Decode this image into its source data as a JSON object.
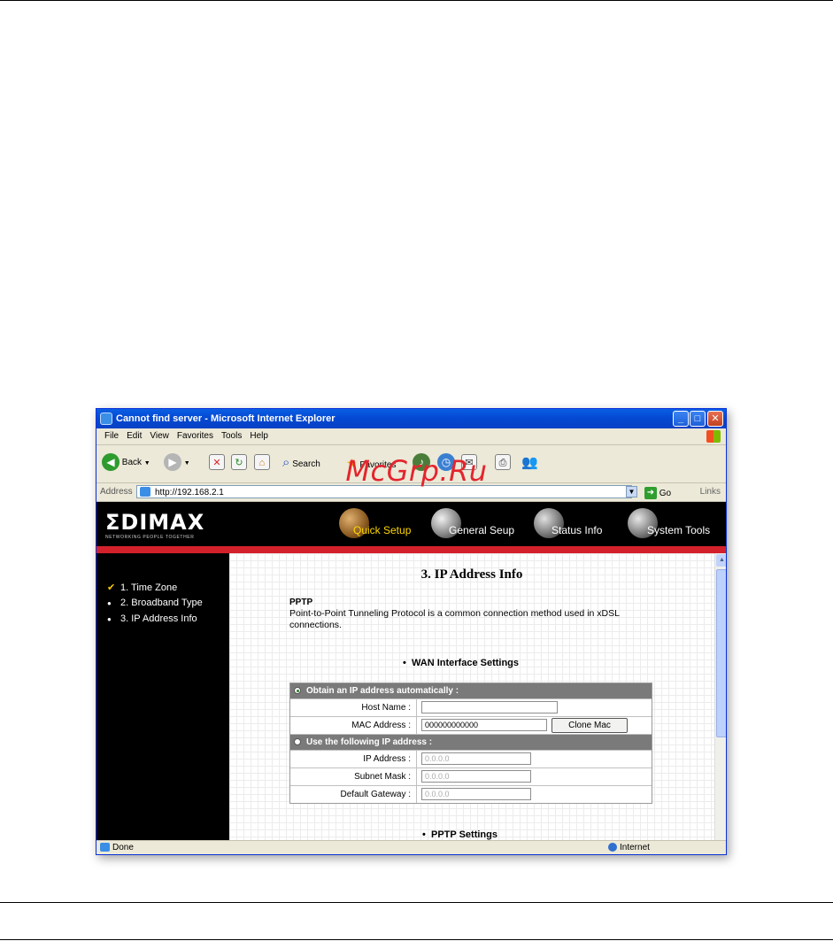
{
  "window": {
    "title": "Cannot find server - Microsoft Internet Explorer",
    "controls": {
      "minimize": "_",
      "maximize": "□",
      "close": "✕"
    }
  },
  "menu": [
    "File",
    "Edit",
    "View",
    "Favorites",
    "Tools",
    "Help"
  ],
  "toolbar": {
    "back_label": "Back",
    "search_label": "Search",
    "favorites_label": "Favorites"
  },
  "addressbar": {
    "label": "Address",
    "url": "http://192.168.2.1",
    "go_label": "Go",
    "links_label": "Links"
  },
  "site": {
    "logo": "ΣDIMAX",
    "logo_tagline": "NETWORKING PEOPLE TOGETHER",
    "nav": [
      "Quick Setup",
      "General Seup",
      "Status Info",
      "System Tools"
    ],
    "nav_active": "Quick Setup"
  },
  "sidebar": {
    "items": [
      "1. Time Zone",
      "2. Broadband Type",
      "3. IP Address Info"
    ],
    "markers": [
      "✔",
      "●",
      "●"
    ]
  },
  "main": {
    "title": "3. IP Address Info",
    "section": "PPTP",
    "description": "Point-to-Point Tunneling Protocol is a common connection method used in xDSL connections.",
    "wan_heading": "WAN Interface Settings",
    "pptp_heading": "PPTP Settings",
    "auto_header": "Obtain an IP address automatically :",
    "host_name_label": "Host Name :",
    "host_name_value": "",
    "mac_label": "MAC Address :",
    "mac_value": "000000000000",
    "clone_mac_label": "Clone Mac",
    "manual_header": "Use the following IP address :",
    "ip_label": "IP Address :",
    "ip_value": "0.0.0.0",
    "subnet_label": "Subnet Mask :",
    "subnet_value": "0.0.0.0",
    "gateway_label": "Default Gateway :",
    "gateway_value": "0.0.0.0"
  },
  "status": {
    "left": "Done",
    "zone": "Internet"
  },
  "watermark": "McGrp.Ru",
  "colors": {
    "accent_red": "#d3212b",
    "xp_blue": "#0449d3",
    "watermark_red": "#e3252d"
  }
}
